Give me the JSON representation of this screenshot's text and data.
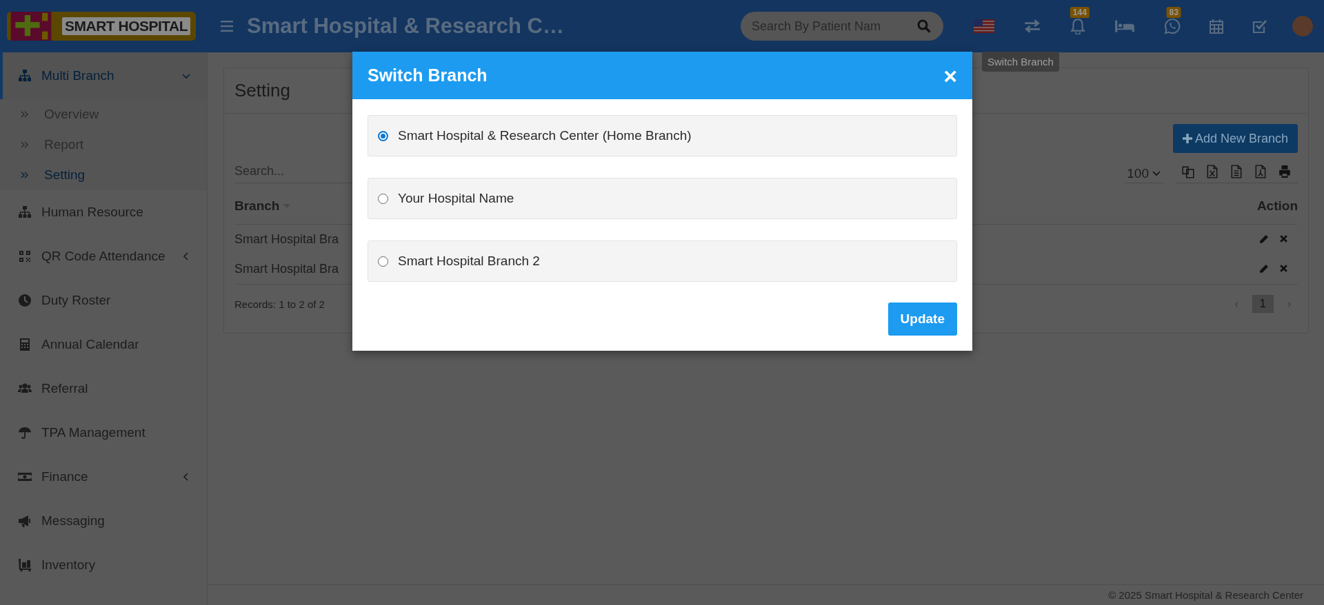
{
  "header": {
    "logo_text": "SMART HOSPITAL",
    "title": "Smart Hospital & Research C…",
    "search": {
      "placeholder": "Search By Patient Nam"
    },
    "notification_badge": "144",
    "whatsapp_badge": "83",
    "tooltip": "Switch Branch"
  },
  "sidebar": {
    "items": [
      {
        "kind": "group",
        "label": "Multi Branch",
        "selected": true,
        "expanded": true,
        "children": [
          {
            "label": "Overview",
            "selected": false
          },
          {
            "label": "Report",
            "selected": false
          },
          {
            "label": "Setting",
            "selected": true
          }
        ]
      },
      {
        "kind": "link",
        "label": "Human Resource",
        "selected": false
      },
      {
        "kind": "group",
        "label": "QR Code Attendance",
        "selected": false,
        "expanded": false
      },
      {
        "kind": "link",
        "label": "Duty Roster",
        "selected": false
      },
      {
        "kind": "link",
        "label": "Annual Calendar",
        "selected": false
      },
      {
        "kind": "link",
        "label": "Referral",
        "selected": false
      },
      {
        "kind": "link",
        "label": "TPA Management",
        "selected": false
      },
      {
        "kind": "group",
        "label": "Finance",
        "selected": false,
        "expanded": false
      },
      {
        "kind": "link",
        "label": "Messaging",
        "selected": false
      },
      {
        "kind": "link",
        "label": "Inventory",
        "selected": false
      }
    ]
  },
  "content": {
    "title": "Setting",
    "add_button": "Add New Branch",
    "search": {
      "placeholder": "Search..."
    },
    "page_size": "100",
    "table": {
      "columns": [
        "Branch",
        "Action"
      ],
      "rows": [
        {
          "branch": "Smart Hospital Bra"
        },
        {
          "branch": "Smart Hospital Bra"
        }
      ]
    },
    "records": "Records: 1 to 2 of 2",
    "pagination": {
      "prev": "‹",
      "pages": [
        {
          "label": "1",
          "selected": true
        }
      ],
      "next": "›"
    }
  },
  "footer": "© 2025 Smart Hospital & Research Center",
  "modal": {
    "title": "Switch Branch",
    "close": "×",
    "options": [
      {
        "label": "Smart Hospital & Research Center (Home Branch)",
        "selected": true
      },
      {
        "label": "Your Hospital Name",
        "selected": false
      },
      {
        "label": "Smart Hospital Branch 2",
        "selected": false
      }
    ],
    "button": "Update"
  }
}
